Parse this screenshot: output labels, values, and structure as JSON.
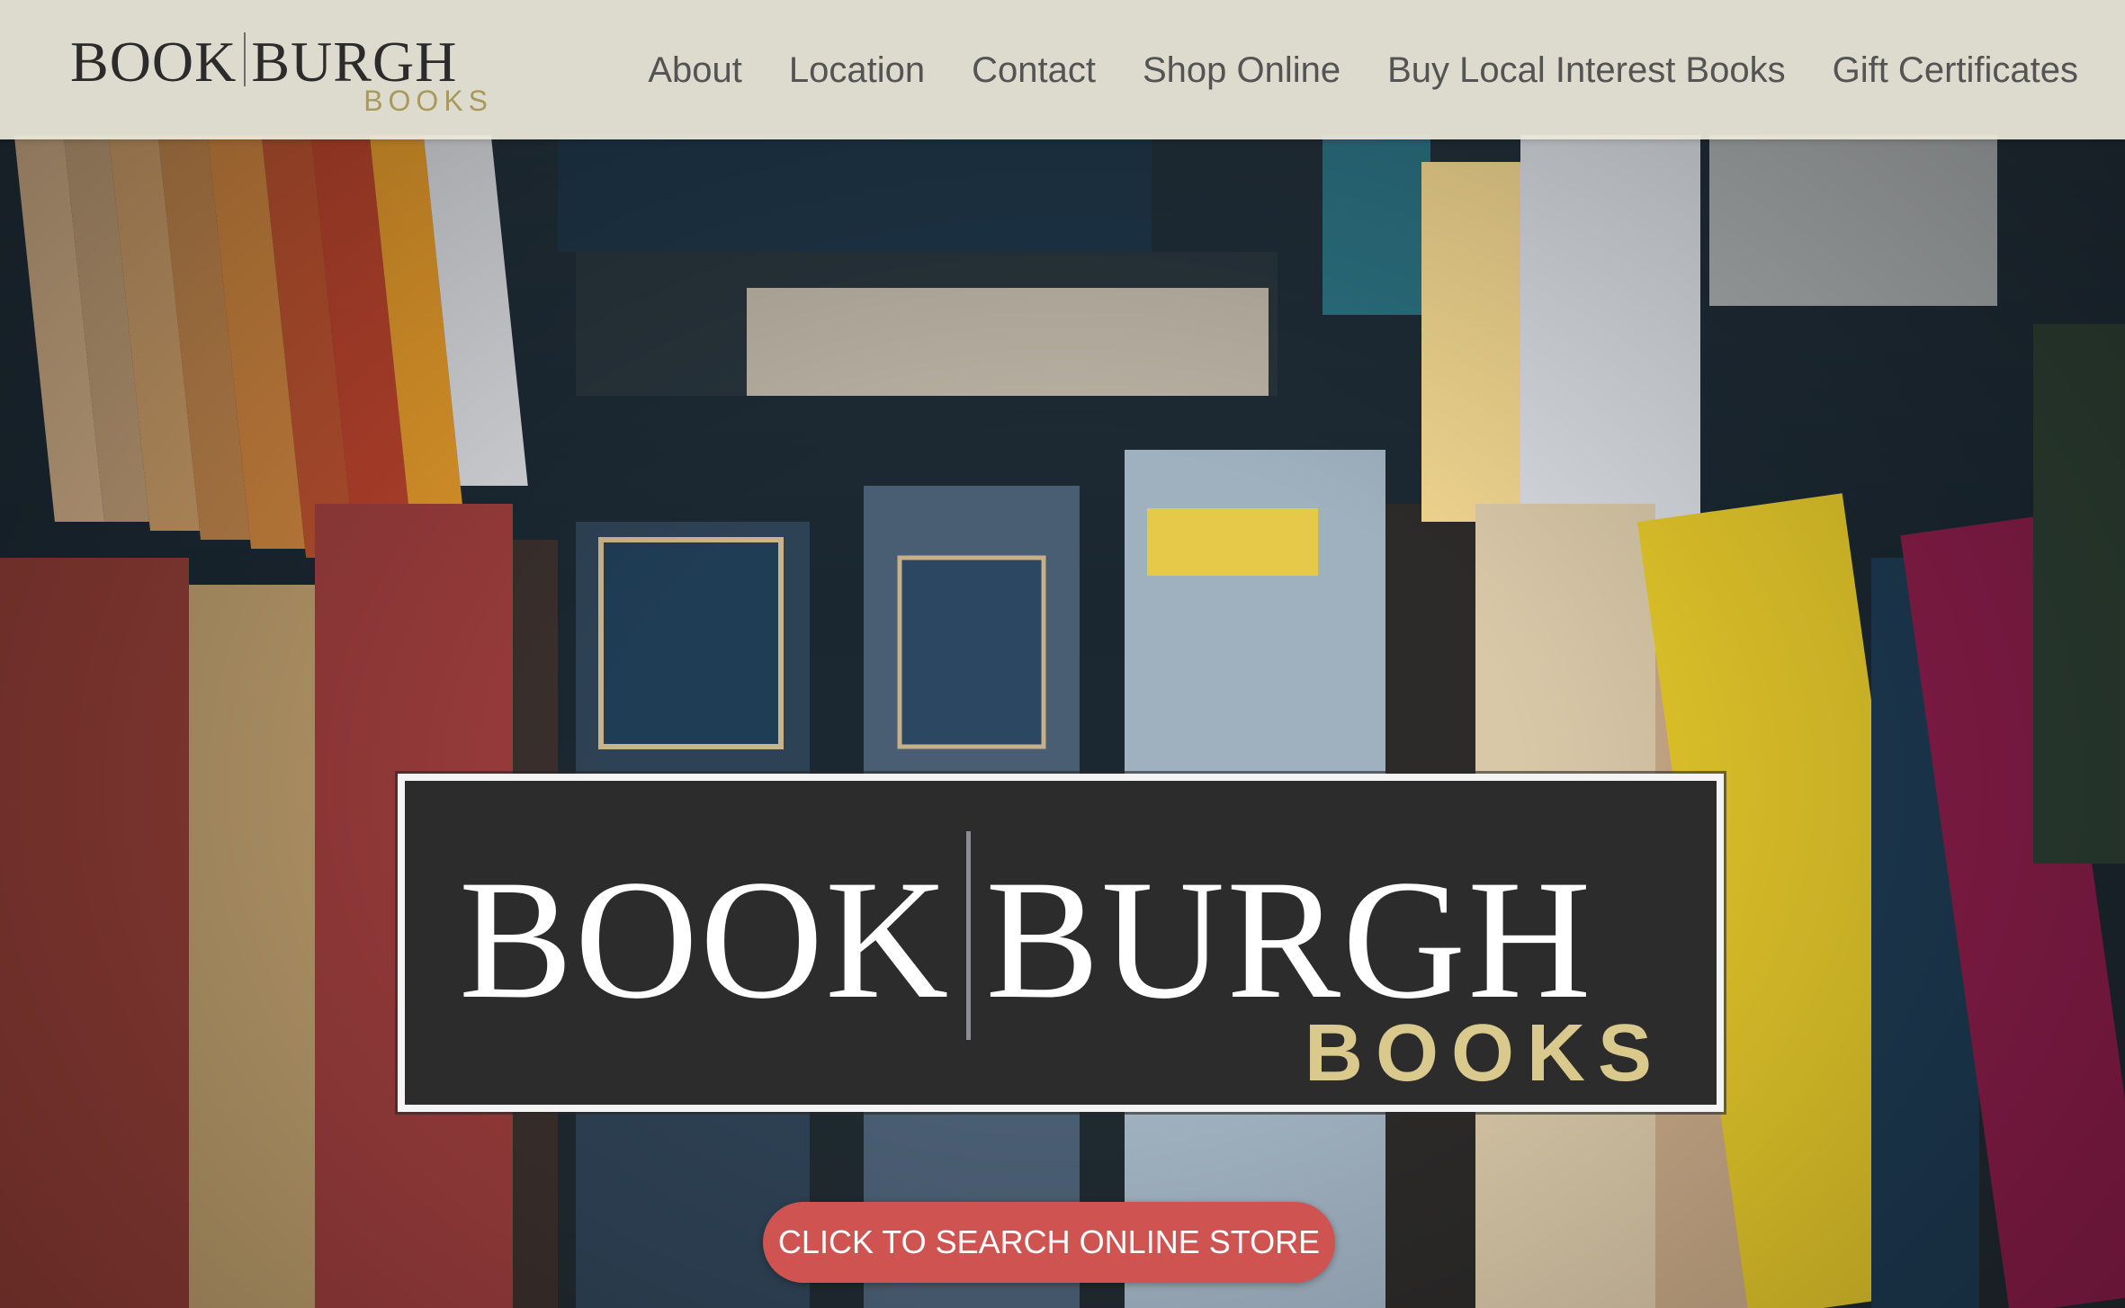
{
  "header": {
    "brand": {
      "word1": "BOOK",
      "word2": "BURGH",
      "sub": "BOOKS"
    },
    "nav": [
      {
        "label": "About"
      },
      {
        "label": "Location"
      },
      {
        "label": "Contact"
      },
      {
        "label": "Shop Online"
      },
      {
        "label": "Buy Local Interest Books"
      },
      {
        "label": "Gift Certificates"
      }
    ]
  },
  "hero": {
    "logo": {
      "word1": "BOOK",
      "word2": "BURGH",
      "sub": "BOOKS"
    },
    "cta_label": "CLICK TO SEARCH ONLINE STORE"
  },
  "colors": {
    "header_bg": "#eceada",
    "brand_sub": "#a9995d",
    "logo_bg": "#2c2c2c",
    "logo_sub": "#d9c98c",
    "cta": "#cf5350"
  }
}
